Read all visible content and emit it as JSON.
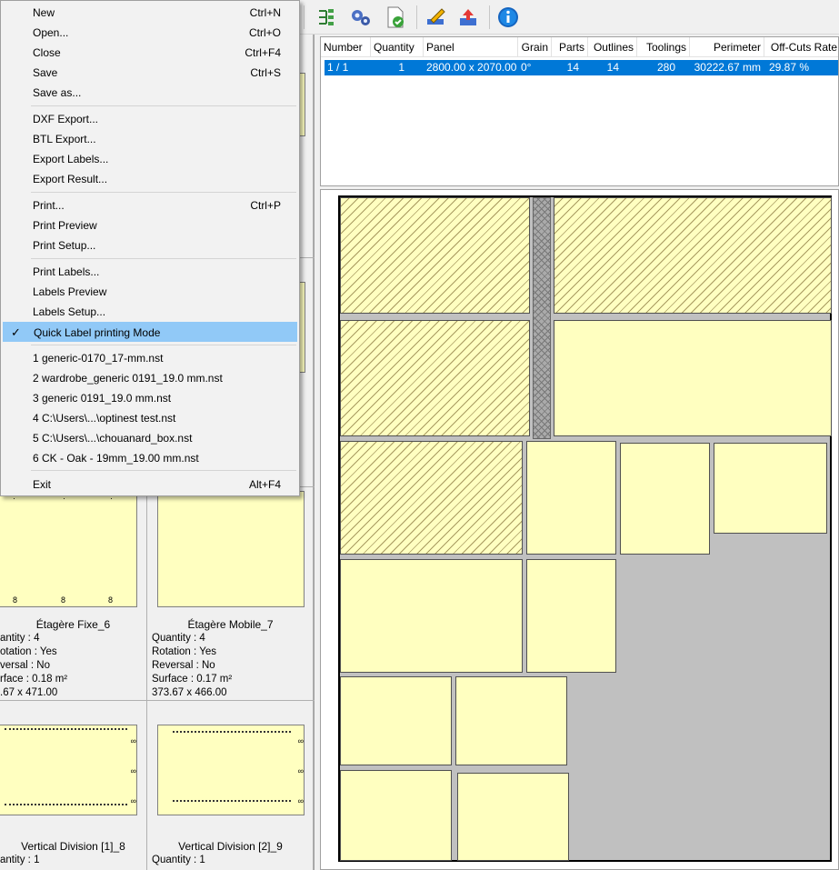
{
  "menu": {
    "items": [
      {
        "label": "New",
        "shortcut": "Ctrl+N"
      },
      {
        "label": "Open...",
        "shortcut": "Ctrl+O"
      },
      {
        "label": "Close",
        "shortcut": "Ctrl+F4"
      },
      {
        "label": "Save",
        "shortcut": "Ctrl+S"
      },
      {
        "label": "Save as...",
        "shortcut": ""
      },
      {
        "label": "DXF Export...",
        "shortcut": ""
      },
      {
        "label": "BTL Export...",
        "shortcut": ""
      },
      {
        "label": "Export Labels...",
        "shortcut": ""
      },
      {
        "label": "Export Result...",
        "shortcut": ""
      },
      {
        "label": "Print...",
        "shortcut": "Ctrl+P"
      },
      {
        "label": "Print Preview",
        "shortcut": ""
      },
      {
        "label": "Print Setup...",
        "shortcut": ""
      },
      {
        "label": "Print Labels...",
        "shortcut": ""
      },
      {
        "label": "Labels Preview",
        "shortcut": ""
      },
      {
        "label": "Labels Setup...",
        "shortcut": ""
      },
      {
        "label": "Quick Label printing Mode",
        "shortcut": "",
        "checked": true
      },
      {
        "label": "1 generic-0170_17-mm.nst",
        "shortcut": ""
      },
      {
        "label": "2 wardrobe_generic 0191_19.0 mm.nst",
        "shortcut": ""
      },
      {
        "label": "3 generic 0191_19.0 mm.nst",
        "shortcut": ""
      },
      {
        "label": "4 C:\\Users\\...\\optinest test.nst",
        "shortcut": ""
      },
      {
        "label": "5 C:\\Users\\...\\chouanard_box.nst",
        "shortcut": ""
      },
      {
        "label": "6 CK - Oak - 19mm_19.00 mm.nst",
        "shortcut": ""
      },
      {
        "label": "Exit",
        "shortcut": "Alt+F4"
      }
    ],
    "check_glyph": "✓"
  },
  "toolbar": {
    "icons": [
      "tree-settings-icon",
      "gears-icon",
      "document-check-icon",
      "edit-pencil-icon",
      "export-icon",
      "info-icon"
    ]
  },
  "results": {
    "headers": [
      "Number",
      "Quantity",
      "Panel",
      "Grain",
      "Parts",
      "Outlines",
      "Toolings",
      "Perimeter",
      "Off-Cuts Rate"
    ],
    "rows": [
      [
        "1 / 1",
        "1",
        "2800.00 x 2070.00",
        "0°",
        "14",
        "14",
        "280",
        "30222.67 mm",
        "29.87 %"
      ]
    ]
  },
  "parts": [
    {
      "name": "Étagère Fixe_6",
      "quantity": "antity : 4",
      "rotation": "otation : Yes",
      "reversal": "versal : No",
      "surface": "rface : 0.18 m²",
      "size": ".67 x 471.00"
    },
    {
      "name": "Étagère Mobile_7",
      "quantity": "Quantity : 4",
      "rotation": "Rotation : Yes",
      "reversal": "Reversal : No",
      "surface": "Surface : 0.17 m²",
      "size": "373.67 x 466.00"
    },
    {
      "name": "Vertical Division [1]_8",
      "quantity": "antity : 1"
    },
    {
      "name": "Vertical Division [2]_9",
      "quantity": "Quantity : 1"
    }
  ],
  "colors": {
    "panel": "#ffffc0",
    "selection": "#0078d7",
    "menu_highlight": "#91c9f7",
    "offcut": "#c0c0c0"
  }
}
